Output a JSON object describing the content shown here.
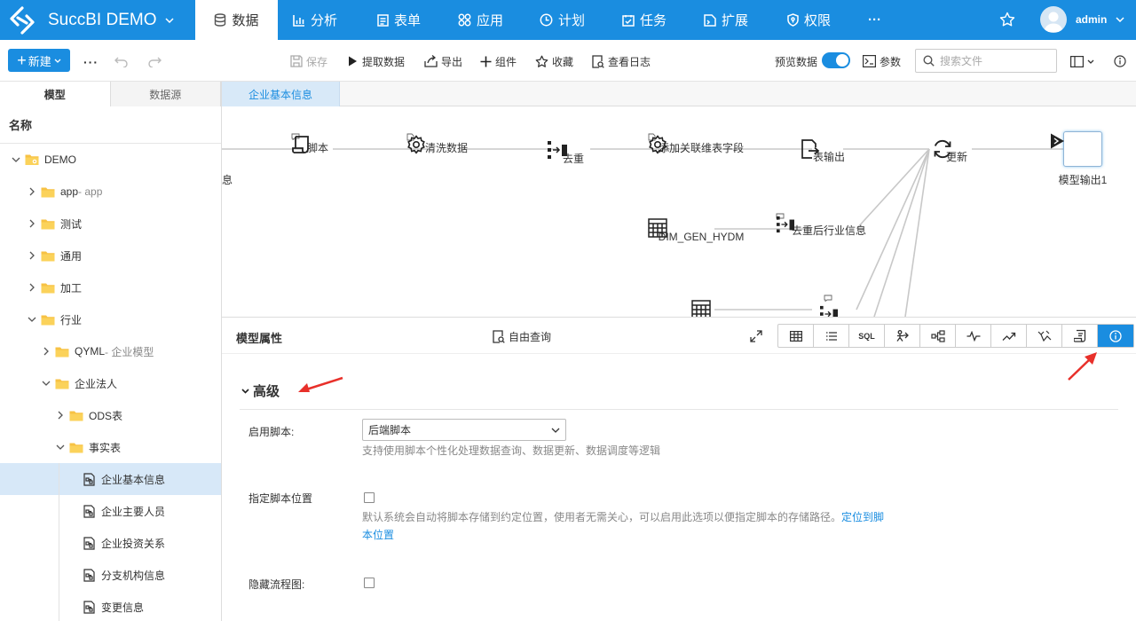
{
  "app": {
    "title": "SuccBI DEMO"
  },
  "nav": {
    "items": [
      {
        "id": "data",
        "label": "数据",
        "icon": "database-icon",
        "active": true
      },
      {
        "id": "analysis",
        "label": "分析",
        "icon": "bar-chart-icon"
      },
      {
        "id": "forms",
        "label": "表单",
        "icon": "form-icon"
      },
      {
        "id": "apps",
        "label": "应用",
        "icon": "apps-icon"
      },
      {
        "id": "plan",
        "label": "计划",
        "icon": "clock-icon"
      },
      {
        "id": "task",
        "label": "任务",
        "icon": "task-icon"
      },
      {
        "id": "ext",
        "label": "扩展",
        "icon": "extension-icon"
      },
      {
        "id": "perm",
        "label": "权限",
        "icon": "shield-icon"
      }
    ],
    "more": "···",
    "user": "admin"
  },
  "toolbar": {
    "new_label": "新建",
    "more": "···",
    "save": "保存",
    "extract": "提取数据",
    "export": "导出",
    "component": "组件",
    "favorite": "收藏",
    "log": "查看日志",
    "preview": "预览数据",
    "params": "参数",
    "search_placeholder": "搜索文件"
  },
  "left_panel": {
    "tabs": [
      "模型",
      "数据源"
    ],
    "header": "名称",
    "tree": [
      {
        "label": "DEMO",
        "sub": "",
        "level": 0,
        "type": "root",
        "expanded": true
      },
      {
        "label": "app",
        "sub": " - app",
        "level": 1,
        "type": "folder",
        "expanded": false
      },
      {
        "label": "测试",
        "sub": "",
        "level": 1,
        "type": "folder",
        "expanded": false
      },
      {
        "label": "通用",
        "sub": "",
        "level": 1,
        "type": "folder",
        "expanded": false
      },
      {
        "label": "加工",
        "sub": "",
        "level": 1,
        "type": "folder",
        "expanded": false
      },
      {
        "label": "行业",
        "sub": "",
        "level": 1,
        "type": "folder",
        "expanded": true
      },
      {
        "label": "QYML",
        "sub": " - 企业模型",
        "level": 2,
        "type": "folder",
        "expanded": false
      },
      {
        "label": "企业法人",
        "sub": "",
        "level": 2,
        "type": "folder",
        "expanded": true
      },
      {
        "label": "ODS表",
        "sub": "",
        "level": 3,
        "type": "folder",
        "expanded": false
      },
      {
        "label": "事实表",
        "sub": "",
        "level": 3,
        "type": "folder",
        "expanded": true
      },
      {
        "label": "企业基本信息",
        "sub": "",
        "level": 4,
        "type": "model",
        "selected": true
      },
      {
        "label": "企业主要人员",
        "sub": "",
        "level": 4,
        "type": "model"
      },
      {
        "label": "企业投资关系",
        "sub": "",
        "level": 4,
        "type": "model"
      },
      {
        "label": "分支机构信息",
        "sub": "",
        "level": 4,
        "type": "model"
      },
      {
        "label": "变更信息",
        "sub": "",
        "level": 4,
        "type": "model"
      }
    ]
  },
  "doc_tab": "企业基本信息",
  "flow": {
    "nodes": [
      {
        "id": "n0",
        "label": "息",
        "icon": "none"
      },
      {
        "id": "n1",
        "label": "脚本",
        "icon": "script-icon"
      },
      {
        "id": "n2",
        "label": "清洗数据",
        "icon": "gear-icon"
      },
      {
        "id": "n3",
        "label": "去重",
        "icon": "dedup-icon"
      },
      {
        "id": "n4",
        "label": "添加关联维表字段",
        "icon": "gear-icon"
      },
      {
        "id": "n5",
        "label": "表输出",
        "icon": "table-output-icon"
      },
      {
        "id": "n6",
        "label": "更新",
        "icon": "refresh-icon"
      },
      {
        "id": "n7",
        "label": "模型输出1",
        "icon": "model-output-icon"
      },
      {
        "id": "n8",
        "label": "DIM_GEN_HYDM",
        "icon": "table-icon"
      },
      {
        "id": "n9",
        "label": "去重后行业信息",
        "icon": "dedup-icon"
      }
    ]
  },
  "props": {
    "title": "模型属性",
    "free_query": "自由查询",
    "view_buttons": [
      {
        "name": "grid-view-button",
        "icon": "grid-icon"
      },
      {
        "name": "list-view-button",
        "icon": "list-icon"
      },
      {
        "name": "sql-view-button",
        "label": "SQL"
      },
      {
        "name": "lineage-button",
        "icon": "lineage-icon"
      },
      {
        "name": "relation-button",
        "icon": "relation-icon"
      },
      {
        "name": "pulse-button",
        "icon": "pulse-icon"
      },
      {
        "name": "trend-button",
        "icon": "trend-icon"
      },
      {
        "name": "compare-button",
        "icon": "compare-icon"
      },
      {
        "name": "script-view-button",
        "icon": "script-doc-icon"
      },
      {
        "name": "info-button",
        "icon": "info-icon",
        "active": true
      }
    ],
    "section": "高级",
    "fields": {
      "enable_script_label": "启用脚本:",
      "enable_script_value": "后端脚本",
      "enable_script_help": "支持使用脚本个性化处理数据查询、数据更新、数据调度等逻辑",
      "script_location_label": "指定脚本位置",
      "script_location_help": "默认系统会自动将脚本存储到约定位置，使用者无需关心，可以启用此选项以便指定脚本的存储路径。",
      "script_location_link": "定位到脚本位置",
      "hide_flow_label": "隐藏流程图:"
    }
  },
  "colors": {
    "primary": "#1a8de0",
    "selected_row": "#d7e8f8",
    "annotation_arrow": "#e8302a"
  }
}
